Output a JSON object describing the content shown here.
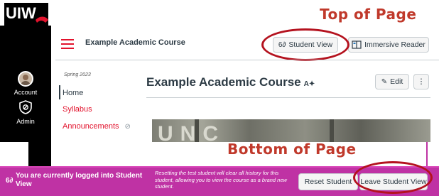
{
  "annotations": {
    "top_label": "Top of Page",
    "bottom_label": "Bottom of Page"
  },
  "global_nav": {
    "logo_text": "UIW",
    "account_label": "Account",
    "admin_label": "Admin"
  },
  "header": {
    "breadcrumb": "Example Academic Course",
    "student_view_label": "Student View",
    "immersive_reader_label": "Immersive Reader"
  },
  "course_nav": {
    "term": "Spring 2023",
    "items": [
      {
        "label": "Home",
        "active": true
      },
      {
        "label": "Syllabus"
      },
      {
        "label": "Announcements"
      }
    ]
  },
  "main": {
    "page_title": "Example Academic Course",
    "edit_label": "Edit",
    "more_label": "⋮",
    "banner_letters": "UNC"
  },
  "student_view_bar": {
    "icon_text": "6∂",
    "message": "You are currently logged into Student View",
    "reset_note": "Resetting the test student will clear all history for this student, allowing you to view the course as a brand new student.",
    "reset_label": "Reset Student",
    "leave_label": "Leave Student View"
  },
  "colors": {
    "brand_red": "#e2132d",
    "student_view_bar": "#bf32a4",
    "annotation_red": "#c0392b"
  }
}
